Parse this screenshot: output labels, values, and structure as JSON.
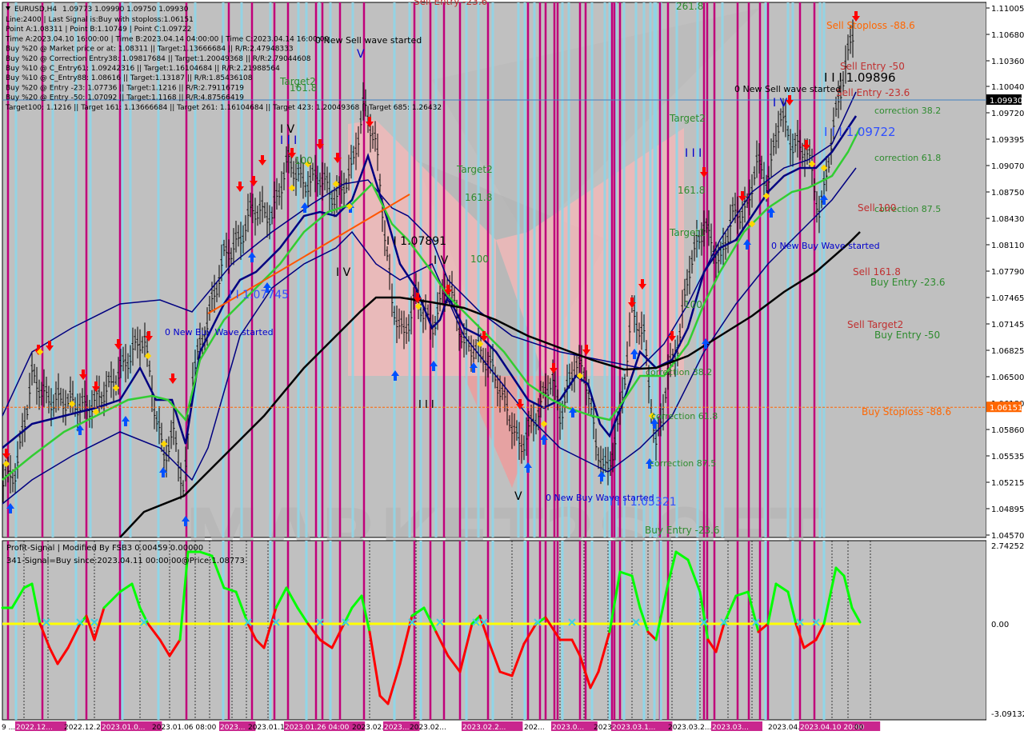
{
  "window": {
    "symbol": "EURUSD,H4",
    "ohlc": "1.09773 1.09990 1.09750 1.09930"
  },
  "info_lines": [
    "Line:2400 | Last Signal is:Buy with stoploss:1.06151",
    "Point A:1.08311 | Point B:1.10749 | Point C:1.09722",
    "Time A:2023.04.10 16:00:00 | Time B:2023.04.14 04:00:00 | Time C:2023.04.14 16:00:00",
    "Buy %20 @ Market price or at: 1.08311 || Target:1.13666684 || R/R:2.47948333",
    "Buy %20 @ Correction Entry38: 1.09817684 || Target:1.20049368 || R/R:2.79044608",
    "Buy %10 @ C_Entry61: 1.09242316 || Target:1.16104684 || R/R:2.21988564",
    "Buy %10 @ C_Entry88: 1.08616 || Target:1.13187 || R/R:1.85436108",
    "Buy %20 @ Entry -23: 1.07736 || Target:1.1216 || R/R:2.79116719",
    "Buy %20 @ Entry -50: 1.07092 || Target:1.1168 || R/R:4.87566419",
    "Target100: 1.1216 || Target 161: 1.13666684 || Target 261: 1.16104684 || Target 423: 1.20049368 || Target 685: 1.26432"
  ],
  "colors": {
    "background": "#ffffff",
    "grid_bg": "#c0c0c0",
    "bull_candle": "#000000",
    "ma_fast": "#000080",
    "ma_mid": "#32cd32",
    "ma_slow": "#000000",
    "buy_arrow": "#0050ff",
    "sell_arrow": "#ff0000",
    "vline_magenta": "#c0007a",
    "vline_cyan": "#8fd6e8",
    "zone_pink": "#f2b8b8",
    "osc_green": "#00ff00",
    "osc_red": "#ff0000",
    "osc_zero": "#ffff00",
    "stoploss_line": "#ff6600",
    "current_price_line": "#4080c0"
  },
  "chart_data": [
    {
      "type": "candlestick",
      "title": "EURUSD,H4",
      "ylim": [
        1.0455,
        1.1113
      ],
      "y_ticks": [
        "1.11005",
        "1.10680",
        "1.10360",
        "1.10040",
        "1.09720",
        "1.09395",
        "1.09070",
        "1.08750",
        "1.08430",
        "1.08110",
        "1.07790",
        "1.07465",
        "1.07145",
        "1.06825",
        "1.06500",
        "1.06180",
        "1.05860",
        "1.05535",
        "1.05215",
        "1.04895",
        "1.04570"
      ],
      "current_price": "1.09930",
      "stoploss_price": "1.06151",
      "x_labels": [
        "9 ...",
        "2022.12...",
        "2022.12.2...",
        "2023.01.0...",
        "2023.01.06 08:00",
        "2023...",
        "2023.01.19",
        "2023.01.26 04:00",
        "2023.02.02",
        "2023...",
        "2023.02...",
        "2023.02.2...",
        "202...",
        "2023.0...",
        "2023.0...",
        "2023.03.1...",
        "2023.03.2...",
        "2023.03...",
        "2023.04...",
        "2023.04.10 20:00",
        "00"
      ],
      "annotations": {
        "sell_stoploss": "Sell Stoploss -88.6",
        "sell_entry_50": "Sell Entry -50",
        "sell_entry_236": "Sell Entry -23.6",
        "correction_382": "correction 38.2",
        "correction_618": "correction 61.8",
        "correction_875": "correction 87.5",
        "sell_100": "Sell 100",
        "sell_1618": "Sell 161.8",
        "buy_entry_236": "Buy Entry -23.6",
        "sell_target2": "Sell Target2",
        "buy_entry_50": "Buy Entry -50",
        "buy_stoploss": "Buy Stoploss -88.6",
        "wave_sell_1": "0 New Sell wave started",
        "wave_sell_2": "0 New Sell wave started",
        "wave_buy_1": "0 New Buy Wave started",
        "wave_buy_2": "0 New Buy Wave started",
        "wave_buy_3": "0 New Buy Wave started",
        "lvl_109896": "I I I 1.09896",
        "lvl_109722": "I I I 1.09722",
        "lvl_107891": "I I 1.07891",
        "lvl_107745": "I I 1.07745",
        "lvl_105321": "I I I 1.05321",
        "target2_a": "Target2",
        "target2_b": "Target2",
        "target2_c": "Target2",
        "target1": "Target1",
        "t1618_a": "161.8",
        "t1618_b": "161.8",
        "t1618_c": "161.8",
        "t100_a": "100",
        "t100_b": "100",
        "t100_c": "100",
        "t2618": "261.8",
        "sell_entry_top": "Sell Entry -23.6",
        "corr_382_mid": "correction 38.2",
        "corr_618_mid": "correction 61.8",
        "corr_875_mid": "correction 87.5",
        "buy_entry_mid": "Buy Entry -23.6",
        "wave_iv_1": "I V",
        "wave_iv_2": "I V",
        "wave_iii": "I I I",
        "wave_v_1": "V",
        "wave_v_2": "V",
        "wave_iii_b": "I I I",
        "wave_iv_b": "I V",
        "wave_iii_c": "I I I",
        "wave_iv_c": "I V"
      },
      "watermark": "MARKET2SOFT"
    },
    {
      "type": "line",
      "title": "Profit-Signal | Modified By FSB3 0.00459 0.00000",
      "subtitle": "341-Signal=Buy since:2023.04.11 00:00:00@Price:1.08773",
      "ylim": [
        -3.09132,
        2.74252
      ],
      "y_ticks": [
        "2.74252",
        "0.00",
        "-3.09132"
      ]
    }
  ]
}
